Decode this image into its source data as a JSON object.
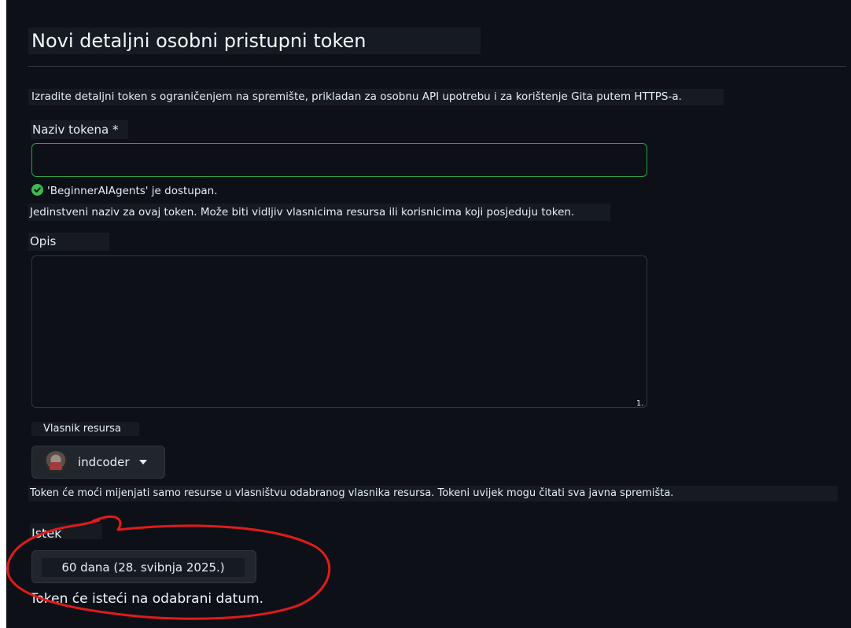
{
  "page": {
    "title": "Novi detaljni osobni pristupni token",
    "intro": "Izradite detaljni token s ograničenjem na spremište, prikladan za osobnu API upotrebu i za korištenje Gita putem HTTPS-a."
  },
  "token_name": {
    "label": "Naziv tokena *",
    "value": "",
    "availability": "'BeginnerAIAgents' je dostupan.",
    "hint": "Jedinstveni naziv za ovaj token. Može biti vidljiv vlasnicima resursa ili korisnicima koji posjeduju token."
  },
  "description": {
    "label": "Opis",
    "value": "",
    "resize_mark": "1."
  },
  "resource_owner": {
    "label": "Vlasnik resursa",
    "selected": "indcoder",
    "hint": "Token će moći mijenjati samo resurse u vlasništvu odabranog vlasnika resursa. Tokeni uvijek mogu čitati sva javna spremišta."
  },
  "expiration": {
    "label": "Istek",
    "selected": "60 dana (28. svibnja 2025.)",
    "hint": "Token će isteći na odabrani datum."
  },
  "colors": {
    "background": "#0d1117",
    "input_valid_border": "#2ea043",
    "annotation_red": "#e01b1b"
  },
  "icons": {
    "availability": "check-circle-icon",
    "owner_dropdown": "caret-down-icon"
  }
}
